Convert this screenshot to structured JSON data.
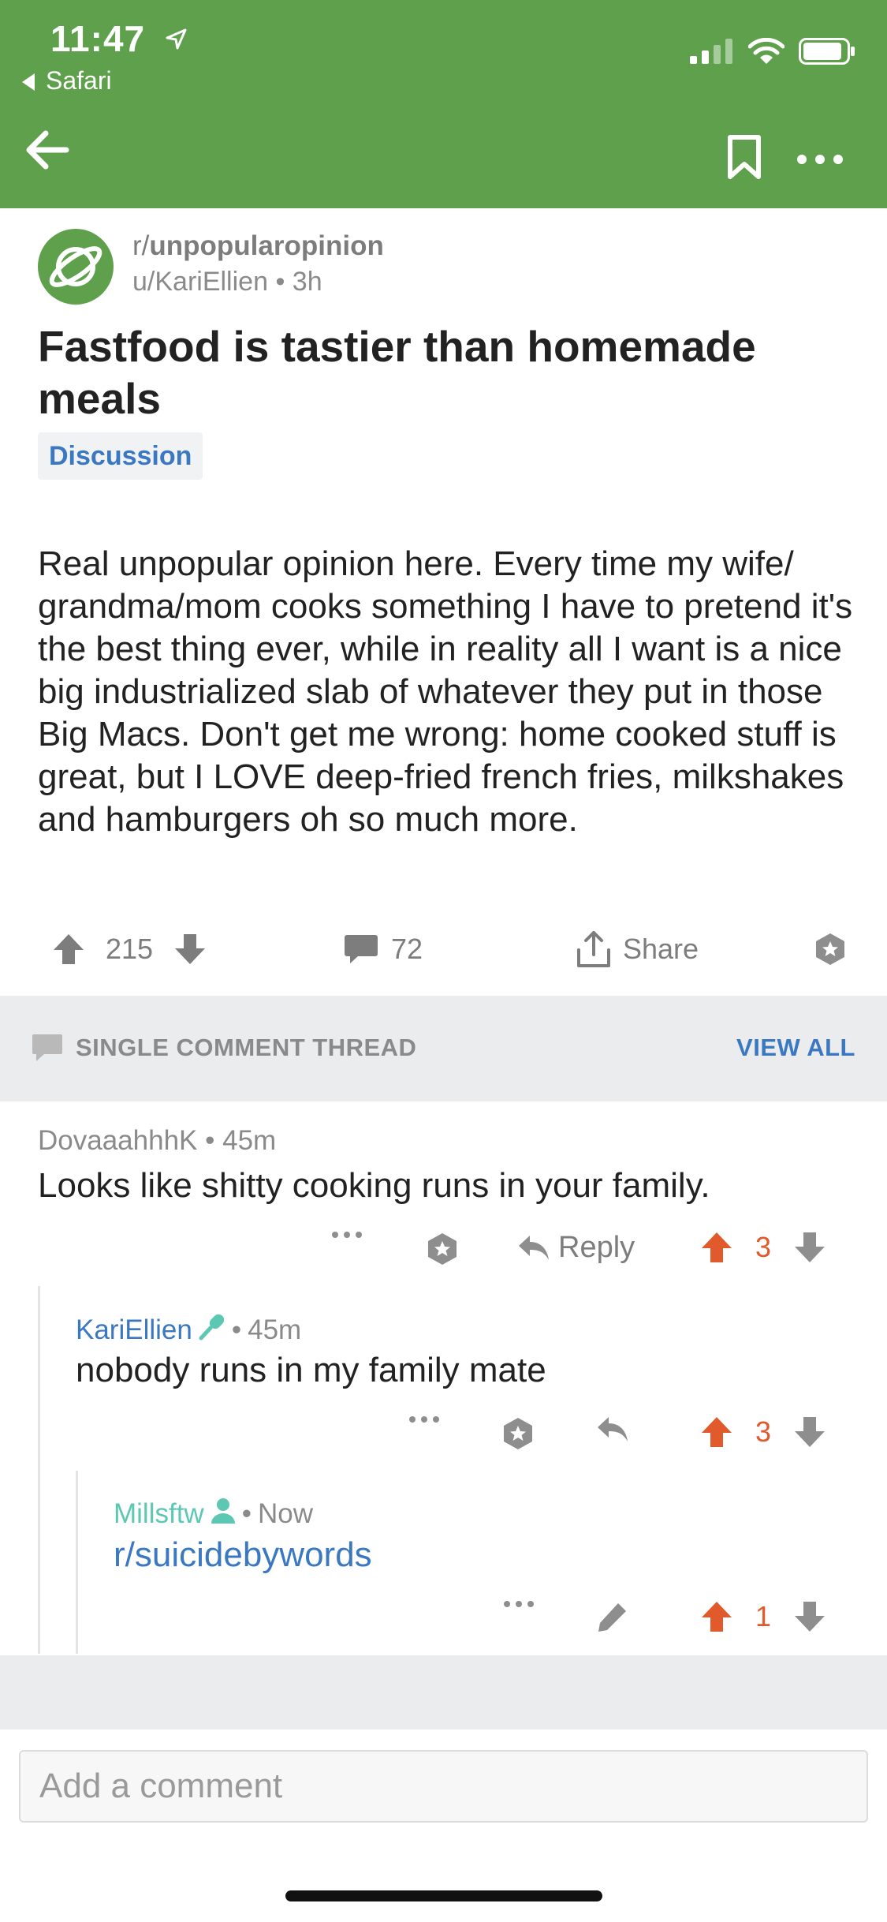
{
  "status_bar": {
    "time": "11:47",
    "back_app": "Safari"
  },
  "post": {
    "subreddit": "r/unpopularopinion",
    "subreddit_prefix": "r/",
    "subreddit_name": "unpopularopinion",
    "author": "u/KariEllien",
    "age": "3h",
    "title": "Fastfood is tastier than homemade meals",
    "flair": "Discussion",
    "body": "Real unpopular opinion here. Every time my wife/ grandma/mom cooks something I have to pretend it's the best thing ever, while in reality all I want is a nice big industrialized slab of whatever they put in those Big Macs. Don't get me wrong: home cooked stuff is great, but I LOVE deep-fried french fries, milkshakes and hamburgers oh so much more.",
    "score": "215",
    "comments": "72",
    "share_label": "Share"
  },
  "thread_header": {
    "title": "SINGLE COMMENT THREAD",
    "view_all": "VIEW ALL"
  },
  "comments": [
    {
      "author": "DovaaahhhK",
      "age": "45m",
      "text": "Looks like shitty cooking runs in your family.",
      "reply_label": "Reply",
      "score": "3"
    },
    {
      "author": "KariEllien",
      "age": "45m",
      "text": "nobody runs in my family mate",
      "score": "3"
    },
    {
      "author": "Millsftw",
      "age": "Now",
      "text": "r/suicidebywords",
      "score": "1"
    }
  ],
  "meta_separator": "•",
  "comment_input": {
    "placeholder": "Add a comment"
  },
  "colors": {
    "header_green": "#5ea04b",
    "link_blue": "#3a78c2",
    "upvote_orange": "#e05a2b",
    "op_teal": "#5cc7b3"
  }
}
